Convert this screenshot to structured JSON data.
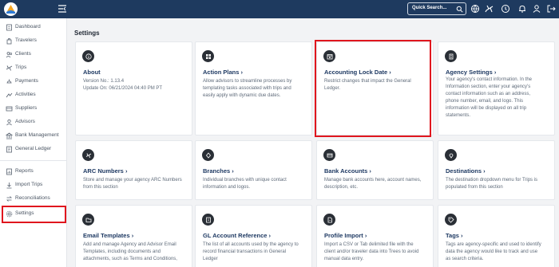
{
  "topbar": {
    "search_placeholder": "Quick Search...",
    "icons": [
      "globe-icon",
      "plane-icon",
      "help-icon",
      "bell-icon",
      "user-icon",
      "logout-icon"
    ]
  },
  "sidebar": {
    "items": [
      {
        "label": "Dashboard",
        "icon": "document-icon"
      },
      {
        "label": "Travelers",
        "icon": "traveler-icon"
      },
      {
        "label": "Clients",
        "icon": "clients-icon"
      },
      {
        "label": "Trips",
        "icon": "plane-icon"
      },
      {
        "label": "Payments",
        "icon": "payments-icon"
      },
      {
        "label": "Activities",
        "icon": "activities-icon"
      },
      {
        "label": "Suppliers",
        "icon": "suppliers-icon"
      },
      {
        "label": "Advisors",
        "icon": "advisors-icon"
      },
      {
        "label": "Bank Management",
        "icon": "bank-icon"
      },
      {
        "label": "General Ledger",
        "icon": "ledger-icon"
      },
      {
        "label": "Reports",
        "icon": "reports-icon"
      },
      {
        "label": "Import Trips",
        "icon": "import-icon"
      },
      {
        "label": "Reconciliations",
        "icon": "reconciliations-icon"
      },
      {
        "label": "Settings",
        "icon": "gear-icon",
        "active": true
      }
    ]
  },
  "main": {
    "title": "Settings",
    "cards": [
      {
        "title": "About",
        "lines": [
          "Version No.: 1.13.4",
          "Update On: 06/21/2024 04:40 PM PT"
        ],
        "arrow": false,
        "icon": "info-icon"
      },
      {
        "title": "Action Plans",
        "lines": [
          "Allow advisors to streamline processes by",
          "templating tasks associated with trips and",
          "easily apply with dynamic due dates."
        ],
        "arrow": true,
        "icon": "grid-icon"
      },
      {
        "title": "Accounting Lock Date",
        "lines": [
          "Restrict changes that impact the General",
          "Ledger."
        ],
        "arrow": true,
        "icon": "calendar-lock-icon"
      },
      {
        "title": "Agency Settings",
        "lines": [
          "Your agency's contact information. In the",
          "Information section, enter your agency's",
          "contact information such as an address,",
          "phone number, email, and logo. This",
          "information will be displayed on all trip",
          "statements."
        ],
        "arrow": true,
        "icon": "building-icon"
      },
      {
        "title": "ARC Numbers",
        "lines": [
          "Store and manage your agency ARC Numbers",
          "from this section"
        ],
        "arrow": true,
        "icon": "plane-icon"
      },
      {
        "title": "Branches",
        "lines": [
          "Individual branches with unique contact",
          "information and logos."
        ],
        "arrow": true,
        "icon": "branch-icon"
      },
      {
        "title": "Bank Accounts",
        "lines": [
          "Manage bank accounts here, account names,",
          "description, etc."
        ],
        "arrow": true,
        "icon": "bank-card-icon"
      },
      {
        "title": "Destinations",
        "lines": [
          "The destination dropdown menu for Trips is",
          "populated from this section"
        ],
        "arrow": true,
        "icon": "map-pin-icon"
      },
      {
        "title": "Email Templates",
        "lines": [
          "Add and manage Agency and Advisor Email",
          "Templates, including documents and",
          "attachments, such as Terms and Conditions,"
        ],
        "arrow": true,
        "icon": "folder-icon"
      },
      {
        "title": "GL Account Reference",
        "lines": [
          "The list of all accounts used by the agency to",
          "record financial transactions in General",
          "Ledger"
        ],
        "arrow": true,
        "icon": "gl-icon"
      },
      {
        "title": "Profile Import",
        "lines": [
          "Import a CSV or Tab delimited file with the",
          "client and/or traveler data into Trees to avoid",
          "manual data entry."
        ],
        "arrow": true,
        "icon": "file-import-icon"
      },
      {
        "title": "Tags",
        "lines": [
          "Tags are agency-specific and used to identify",
          "data the agency would like to track and use",
          "as search criteria."
        ],
        "arrow": true,
        "icon": "tag-icon"
      }
    ]
  }
}
